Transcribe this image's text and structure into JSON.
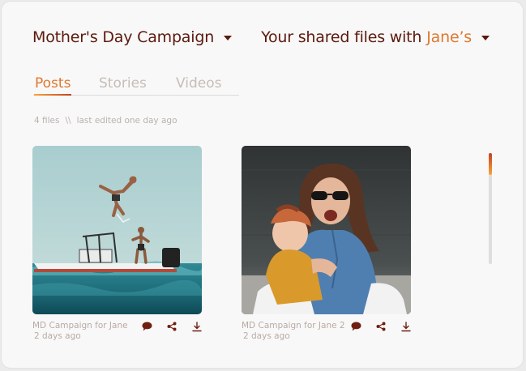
{
  "header": {
    "campaign_title": "Mother's Day Campaign",
    "shared_prefix": "Your shared files with",
    "shared_user": "Jane’s"
  },
  "tabs": [
    {
      "label": "Posts",
      "active": true
    },
    {
      "label": "Stories",
      "active": false
    },
    {
      "label": "Videos",
      "active": false
    }
  ],
  "meta": {
    "file_count": "4 files",
    "separator": "\\\\",
    "last_edited": "last edited one day ago"
  },
  "files": [
    {
      "name": "MD Campaign for Jane",
      "date": "2 days ago",
      "image": "people jumping off boat into sea"
    },
    {
      "name": "MD Campaign for Jane 2",
      "date": "2 days ago",
      "image": "woman with sunglasses holding toddler"
    }
  ],
  "icons": {
    "comment": "comment-icon",
    "share": "share-icon",
    "download": "download-icon",
    "dropdown": "chevron-down-icon"
  },
  "colors": {
    "heading": "#5c1a0e",
    "accent": "#e0782e",
    "icon": "#6e1f10",
    "muted": "#b8aba3"
  },
  "scrollbar": {
    "position": 0.0,
    "visible_fraction": 0.2
  }
}
